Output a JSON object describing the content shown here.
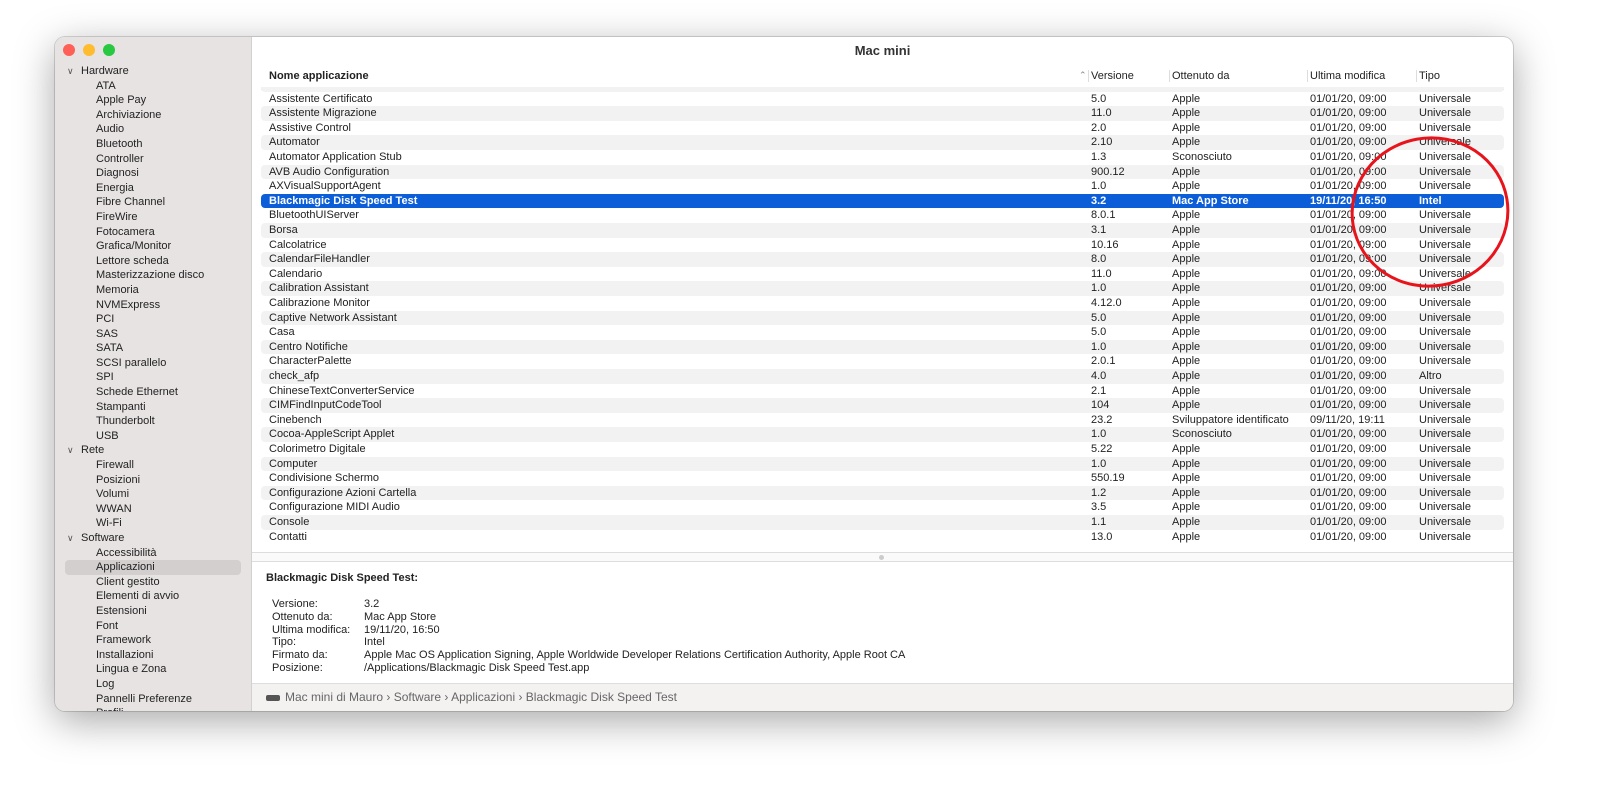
{
  "window": {
    "title": "Mac mini"
  },
  "sidebar": {
    "sections": [
      {
        "label": "Hardware",
        "items": [
          "ATA",
          "Apple Pay",
          "Archiviazione",
          "Audio",
          "Bluetooth",
          "Controller",
          "Diagnosi",
          "Energia",
          "Fibre Channel",
          "FireWire",
          "Fotocamera",
          "Grafica/Monitor",
          "Lettore scheda",
          "Masterizzazione disco",
          "Memoria",
          "NVMExpress",
          "PCI",
          "SAS",
          "SATA",
          "SCSI parallelo",
          "SPI",
          "Schede Ethernet",
          "Stampanti",
          "Thunderbolt",
          "USB"
        ]
      },
      {
        "label": "Rete",
        "items": [
          "Firewall",
          "Posizioni",
          "Volumi",
          "WWAN",
          "Wi-Fi"
        ]
      },
      {
        "label": "Software",
        "items": [
          "Accessibilità",
          "Applicazioni",
          "Client gestito",
          "Elementi di avvio",
          "Estensioni",
          "Font",
          "Framework",
          "Installazioni",
          "Lingua e Zona",
          "Log",
          "Pannelli Preferenze",
          "Profili"
        ]
      }
    ],
    "selected": "Applicazioni"
  },
  "table": {
    "columns": [
      "Nome applicazione",
      "Versione",
      "Ottenuto da",
      "Ultima modifica",
      "Tipo"
    ],
    "rows": [
      [
        "Assistente Certificato",
        "5.0",
        "Apple",
        "01/01/20, 09:00",
        "Universale"
      ],
      [
        "Assistente Migrazione",
        "11.0",
        "Apple",
        "01/01/20, 09:00",
        "Universale"
      ],
      [
        "Assistive Control",
        "2.0",
        "Apple",
        "01/01/20, 09:00",
        "Universale"
      ],
      [
        "Automator",
        "2.10",
        "Apple",
        "01/01/20, 09:00",
        "Universale"
      ],
      [
        "Automator Application Stub",
        "1.3",
        "Sconosciuto",
        "01/01/20, 09:00",
        "Universale"
      ],
      [
        "AVB Audio Configuration",
        "900.12",
        "Apple",
        "01/01/20, 09:00",
        "Universale"
      ],
      [
        "AXVisualSupportAgent",
        "1.0",
        "Apple",
        "01/01/20, 09:00",
        "Universale"
      ],
      [
        "Blackmagic Disk Speed Test",
        "3.2",
        "Mac App Store",
        "19/11/20, 16:50",
        "Intel"
      ],
      [
        "BluetoothUIServer",
        "8.0.1",
        "Apple",
        "01/01/20, 09:00",
        "Universale"
      ],
      [
        "Borsa",
        "3.1",
        "Apple",
        "01/01/20, 09:00",
        "Universale"
      ],
      [
        "Calcolatrice",
        "10.16",
        "Apple",
        "01/01/20, 09:00",
        "Universale"
      ],
      [
        "CalendarFileHandler",
        "8.0",
        "Apple",
        "01/01/20, 09:00",
        "Universale"
      ],
      [
        "Calendario",
        "11.0",
        "Apple",
        "01/01/20, 09:00",
        "Universale"
      ],
      [
        "Calibration Assistant",
        "1.0",
        "Apple",
        "01/01/20, 09:00",
        "Universale"
      ],
      [
        "Calibrazione Monitor",
        "4.12.0",
        "Apple",
        "01/01/20, 09:00",
        "Universale"
      ],
      [
        "Captive Network Assistant",
        "5.0",
        "Apple",
        "01/01/20, 09:00",
        "Universale"
      ],
      [
        "Casa",
        "5.0",
        "Apple",
        "01/01/20, 09:00",
        "Universale"
      ],
      [
        "Centro Notifiche",
        "1.0",
        "Apple",
        "01/01/20, 09:00",
        "Universale"
      ],
      [
        "CharacterPalette",
        "2.0.1",
        "Apple",
        "01/01/20, 09:00",
        "Universale"
      ],
      [
        "check_afp",
        "4.0",
        "Apple",
        "01/01/20, 09:00",
        "Altro"
      ],
      [
        "ChineseTextConverterService",
        "2.1",
        "Apple",
        "01/01/20, 09:00",
        "Universale"
      ],
      [
        "CIMFindInputCodeTool",
        "104",
        "Apple",
        "01/01/20, 09:00",
        "Universale"
      ],
      [
        "Cinebench",
        "23.2",
        "Sviluppatore identificato",
        "09/11/20, 19:11",
        "Universale"
      ],
      [
        "Cocoa-AppleScript Applet",
        "1.0",
        "Sconosciuto",
        "01/01/20, 09:00",
        "Universale"
      ],
      [
        "Colorimetro Digitale",
        "5.22",
        "Apple",
        "01/01/20, 09:00",
        "Universale"
      ],
      [
        "Computer",
        "1.0",
        "Apple",
        "01/01/20, 09:00",
        "Universale"
      ],
      [
        "Condivisione Schermo",
        "550.19",
        "Apple",
        "01/01/20, 09:00",
        "Universale"
      ],
      [
        "Configurazione Azioni Cartella",
        "1.2",
        "Apple",
        "01/01/20, 09:00",
        "Universale"
      ],
      [
        "Configurazione MIDI Audio",
        "3.5",
        "Apple",
        "01/01/20, 09:00",
        "Universale"
      ],
      [
        "Console",
        "1.1",
        "Apple",
        "01/01/20, 09:00",
        "Universale"
      ],
      [
        "Contatti",
        "13.0",
        "Apple",
        "01/01/20, 09:00",
        "Universale"
      ]
    ],
    "selected_index": 7
  },
  "detail": {
    "title": "Blackmagic Disk Speed Test:",
    "fields": [
      [
        "Versione:",
        "3.2"
      ],
      [
        "Ottenuto da:",
        "Mac App Store"
      ],
      [
        "Ultima modifica:",
        "19/11/20, 16:50"
      ],
      [
        "Tipo:",
        "Intel"
      ],
      [
        "Firmato da:",
        "Apple Mac OS Application Signing, Apple Worldwide Developer Relations Certification Authority, Apple Root CA"
      ],
      [
        "Posizione:",
        "/Applications/Blackmagic Disk Speed Test.app"
      ]
    ]
  },
  "breadcrumb": [
    "Mac mini di Mauro",
    "Software",
    "Applicazioni",
    "Blackmagic Disk Speed Test"
  ],
  "colors": {
    "selection": "#0b5ed7",
    "annotation": "#e8141c",
    "close": "#fe5f57",
    "minimize": "#febc2e",
    "zoom": "#28c840"
  }
}
